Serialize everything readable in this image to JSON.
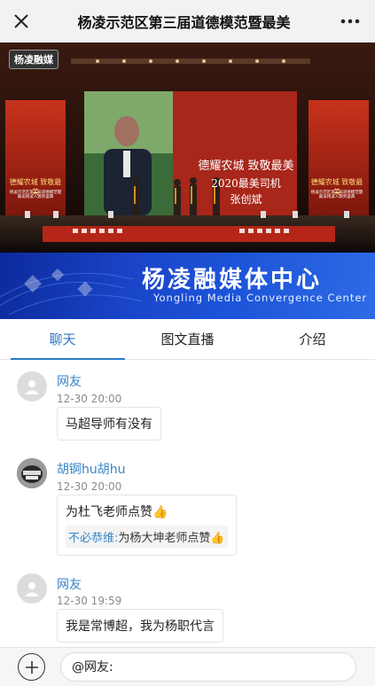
{
  "topbar": {
    "title": "杨凌示范区第三届道德模范暨最美",
    "close_icon": "close-icon",
    "more_icon": "more-dots-icon"
  },
  "video": {
    "logo_text": "杨凌融媒",
    "screen_line1": "德耀农城 致敬最美",
    "screen_line2": "2020最美司机",
    "screen_line3": "张创斌",
    "side_title": "德耀农城 致敬最美",
    "side_sub": "杨凌示范区第三届道德模范暨最美杨凌人颁奖盛典"
  },
  "banner": {
    "title": "杨凌融媒体中心",
    "subtitle": "Yongling Media Convergence Center"
  },
  "tabs": [
    {
      "label": "聊天",
      "active": true
    },
    {
      "label": "图文直播",
      "active": false
    },
    {
      "label": "介绍",
      "active": false
    }
  ],
  "messages": [
    {
      "nick": "网友",
      "time": "12-30 20:00",
      "text": "马超导师有没有"
    },
    {
      "nick": "胡锕hu胡hu",
      "time": "12-30 20:00",
      "text": "为杜飞老师点赞",
      "quote_name": "不必恭维:",
      "quote_text": "为杨大坤老师点赞"
    },
    {
      "nick": "网友",
      "time": "12-30 19:59",
      "text": "我是常博超，我为杨职代言"
    }
  ],
  "input": {
    "value": "@网友:"
  },
  "colors": {
    "accent": "#2d79c7",
    "banner": "#1a45c8"
  }
}
